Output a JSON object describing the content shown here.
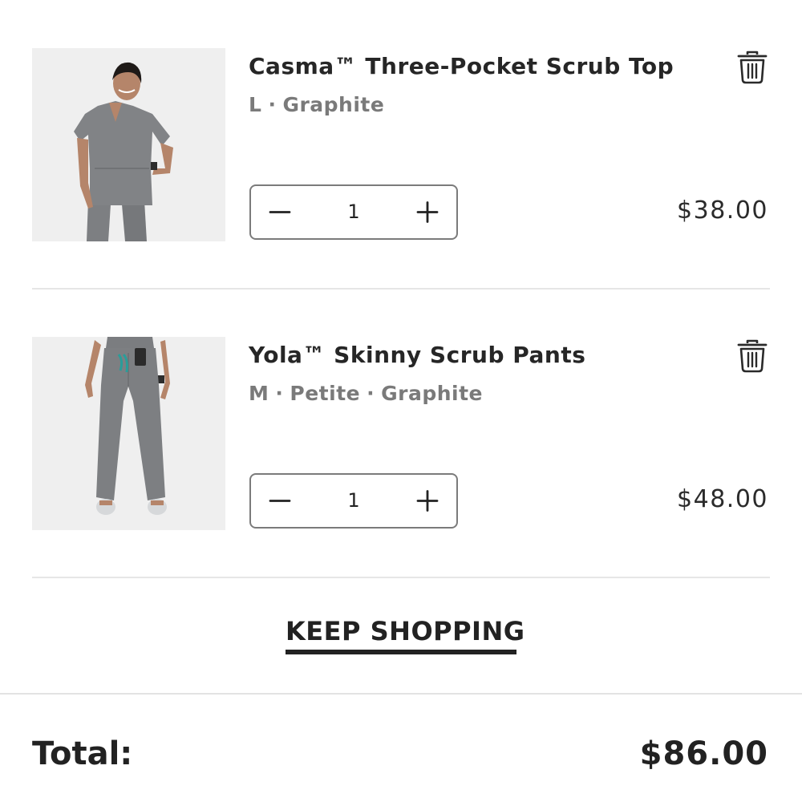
{
  "cart": {
    "items": [
      {
        "title": "Casma™ Three-Pocket Scrub Top",
        "options": [
          "L",
          "Graphite"
        ],
        "quantity": "1",
        "price": "$38.00"
      },
      {
        "title": "Yola™ Skinny Scrub Pants",
        "options": [
          "M",
          "Petite",
          "Graphite"
        ],
        "quantity": "1",
        "price": "$48.00"
      }
    ],
    "option_separator": "·",
    "keep_shopping_label": "KEEP SHOPPING",
    "total_label": "Total:",
    "total_value": "$86.00"
  },
  "colors": {
    "text": "#222222",
    "muted": "#7a7a7a",
    "fabric_graphite": "#7d7f82",
    "image_background": "#efefef",
    "pant_drawstring": "#2a9d9a"
  },
  "icons": {
    "delete": "trash-icon",
    "decrease": "minus-icon",
    "increase": "plus-icon"
  }
}
